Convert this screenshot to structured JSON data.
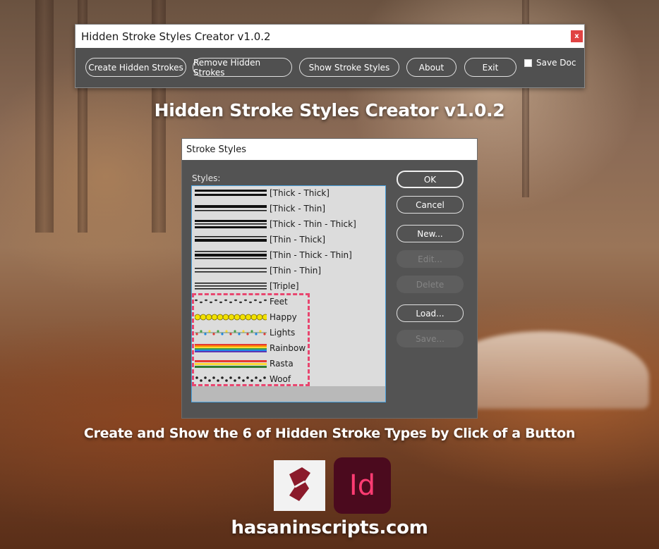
{
  "main_window": {
    "title": "Hidden Stroke Styles Creator v1.0.2",
    "close_label": "x",
    "buttons": [
      {
        "label": "Create Hidden Strokes"
      },
      {
        "label": "Remove Hidden Strokes"
      },
      {
        "label": "Show Stroke Styles"
      },
      {
        "label": "About"
      },
      {
        "label": "Exit"
      }
    ],
    "save_doc": {
      "label": "Save Doc",
      "checked": false
    }
  },
  "heading": "Hidden Stroke Styles Creator v1.0.2",
  "subheading": "Create and Show the 6 of Hidden Stroke Types by Click of a Button",
  "website": "hasaninscripts.com",
  "dialog": {
    "title": "Stroke Styles",
    "styles_label": "Styles:",
    "styles": [
      {
        "label": "[Thick - Thick]",
        "preview": "thick-thick"
      },
      {
        "label": "[Thick - Thin]",
        "preview": "thick-thin"
      },
      {
        "label": "[Thick - Thin - Thick]",
        "preview": "thick-thin-thick"
      },
      {
        "label": "[Thin - Thick]",
        "preview": "thin-thick"
      },
      {
        "label": "[Thin - Thick - Thin]",
        "preview": "thin-thick-thin"
      },
      {
        "label": "[Thin - Thin]",
        "preview": "thin-thin"
      },
      {
        "label": "[Triple]",
        "preview": "triple"
      },
      {
        "label": "Feet",
        "preview": "feet"
      },
      {
        "label": "Happy",
        "preview": "happy"
      },
      {
        "label": "Lights",
        "preview": "lights"
      },
      {
        "label": "Rainbow",
        "preview": "rainbow"
      },
      {
        "label": "Rasta",
        "preview": "rasta"
      },
      {
        "label": "Woof",
        "preview": "woof"
      }
    ],
    "buttons": [
      {
        "label": "OK",
        "enabled": true
      },
      {
        "label": "Cancel",
        "enabled": true
      },
      {
        "label": "New...",
        "enabled": true
      },
      {
        "label": "Edit...",
        "enabled": false
      },
      {
        "label": "Delete",
        "enabled": false
      },
      {
        "label": "Load...",
        "enabled": true
      },
      {
        "label": "Save...",
        "enabled": false
      }
    ]
  },
  "logos": {
    "script_logo_icon": "script-scroll-icon",
    "indesign_logo_text": "Id"
  },
  "colors": {
    "highlight": "#e8466f",
    "list_selection_border": "#4aa3e0",
    "indesign_bg": "#4b0a1e",
    "indesign_text": "#ff3c73",
    "script_logo": "#8b1a2b"
  }
}
